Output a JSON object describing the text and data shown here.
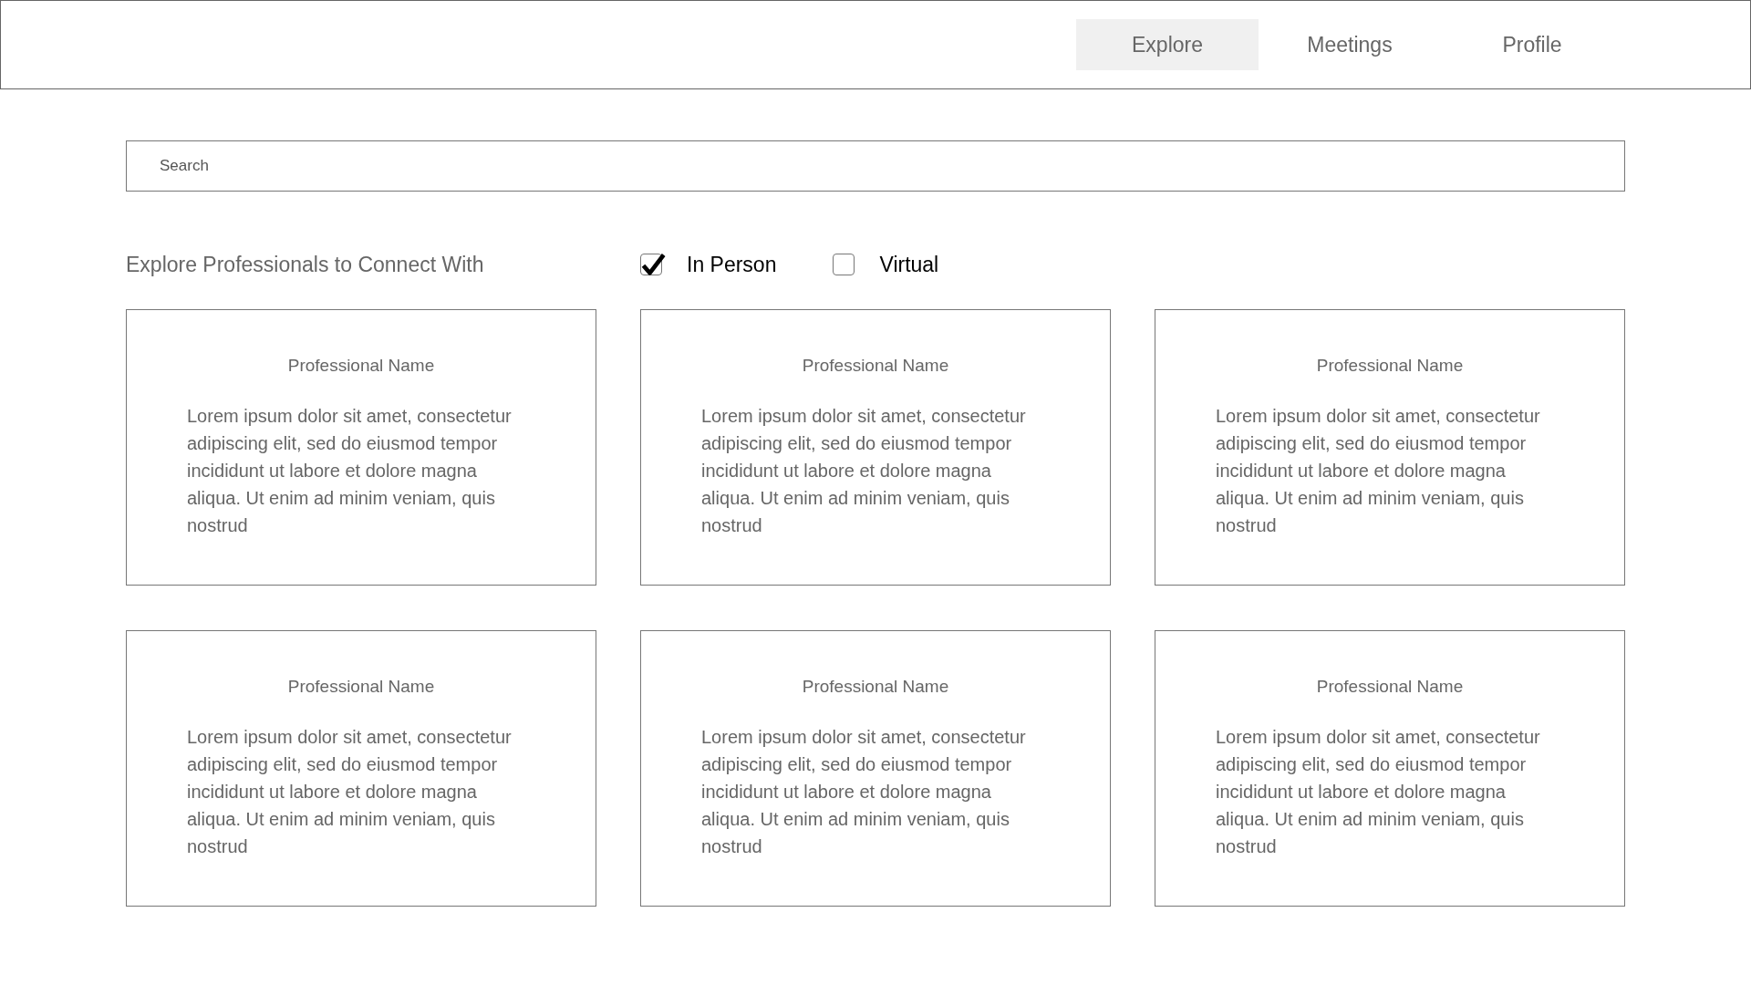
{
  "nav": {
    "tabs": [
      {
        "label": "Explore",
        "selected": true
      },
      {
        "label": "Meetings",
        "selected": false
      },
      {
        "label": "Profile",
        "selected": false
      }
    ]
  },
  "search": {
    "placeholder": "Search"
  },
  "heading": "Explore Professionals to Connect With",
  "filters": [
    {
      "label": "In Person",
      "checked": true
    },
    {
      "label": "Virtual",
      "checked": false
    }
  ],
  "cards": [
    {
      "name": "Professional Name",
      "description": "Lorem ipsum dolor sit amet, consectetur adipiscing elit, sed do eiusmod tempor incididunt ut labore et dolore magna aliqua. Ut enim ad minim veniam, quis nostrud"
    },
    {
      "name": "Professional Name",
      "description": "Lorem ipsum dolor sit amet, consectetur adipiscing elit, sed do eiusmod tempor incididunt ut labore et dolore magna aliqua. Ut enim ad minim veniam, quis nostrud"
    },
    {
      "name": "Professional Name",
      "description": "Lorem ipsum dolor sit amet, consectetur adipiscing elit, sed do eiusmod tempor incididunt ut labore et dolore magna aliqua. Ut enim ad minim veniam, quis nostrud"
    },
    {
      "name": "Professional Name",
      "description": "Lorem ipsum dolor sit amet, consectetur adipiscing elit, sed do eiusmod tempor incididunt ut labore et dolore magna aliqua. Ut enim ad minim veniam, quis nostrud"
    },
    {
      "name": "Professional Name",
      "description": "Lorem ipsum dolor sit amet, consectetur adipiscing elit, sed do eiusmod tempor incididunt ut labore et dolore magna aliqua. Ut enim ad minim veniam, quis nostrud"
    },
    {
      "name": "Professional Name",
      "description": "Lorem ipsum dolor sit amet, consectetur adipiscing elit, sed do eiusmod tempor incididunt ut labore et dolore magna aliqua. Ut enim ad minim veniam, quis nostrud"
    }
  ]
}
